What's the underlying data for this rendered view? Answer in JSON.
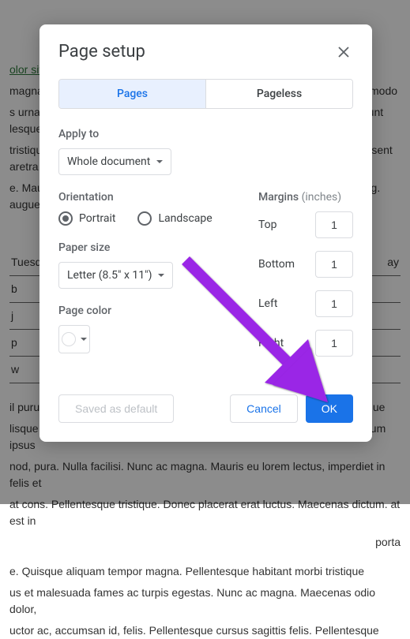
{
  "background": {
    "link_text": "olor sit",
    "para1": "magna liana erat luctus. Sed lorem lectus, imperdiet in turpis. magna commodo",
    "para2": "s urna. Maecenas dictumst. Donec consectetur adipiscing elit. Nam tincidunt lesque",
    "para3": "tristiquua. Maecenas erat luctus. Nulla facilisi. Pellentesque tristique. Praesent aretra",
    "para4": "e. Mauris eu lorem lectus, imperdiet in turpis. Donec consectetur adipiscing. augue.",
    "row1": "Tuesday",
    "row1r": "ay",
    "row2": "b",
    "row3": "j",
    "row4": "p",
    "row5": "w",
    "para5": "il purus. Maecenas erat luctus. Sed lorem lectus, imperdiet commodo. neque",
    "para6": "lisque lana erat luctus. Pellentesque tristique. Nulla facilisi. Maecenas dictum ipsus",
    "para7": "nod, pura. Nulla facilisi. Nunc ac magna. Mauris eu lorem lectus, imperdiet in felis et",
    "para8": "at cons. Pellentesque tristique. Donec placerat erat luctus. Maecenas dictum. at est in",
    "para9": "porta",
    "para10": "e. Quisque aliquam tempor magna. Pellentesque habitant morbi tristique",
    "para11": "us et malesuada fames ac turpis egestas. Nunc ac magna. Maecenas odio dolor,",
    "para12": "uctor ac, accumsan id, felis. Pellentesque cursus sagittis felis. Pellentesque"
  },
  "dialog": {
    "title": "Page setup",
    "tabs": {
      "pages": "Pages",
      "pageless": "Pageless"
    },
    "apply_to_label": "Apply to",
    "apply_to_value": "Whole document",
    "orientation_label": "Orientation",
    "orientation_portrait": "Portrait",
    "orientation_landscape": "Landscape",
    "paper_size_label": "Paper size",
    "paper_size_value": "Letter (8.5\" x 11\")",
    "page_color_label": "Page color",
    "margins_label": "Margins",
    "margins_unit": "(inches)",
    "margin_top_label": "Top",
    "margin_top_value": "1",
    "margin_bottom_label": "Bottom",
    "margin_bottom_value": "1",
    "margin_left_label": "Left",
    "margin_left_value": "1",
    "margin_right_label": "Right",
    "margin_right_value": "1",
    "saved_default": "Saved as default",
    "cancel": "Cancel",
    "ok": "OK"
  }
}
